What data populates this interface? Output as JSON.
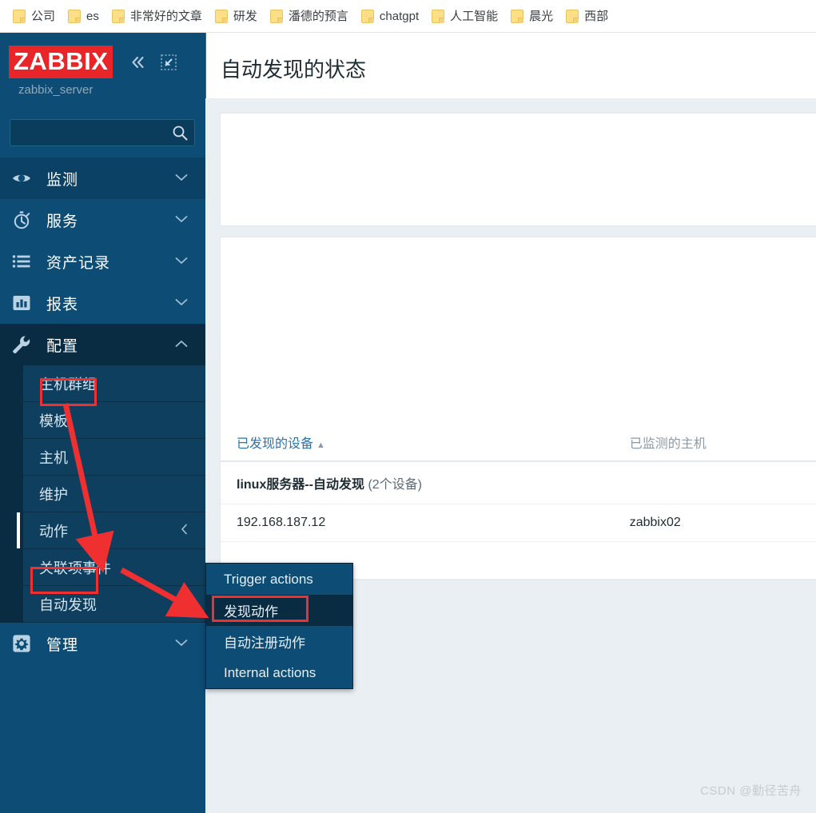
{
  "bookmarks": [
    {
      "label": "公司",
      "icon": "folder-icon"
    },
    {
      "label": "es",
      "icon": "folder-icon"
    },
    {
      "label": "非常好的文章",
      "icon": "folder-icon"
    },
    {
      "label": "研发",
      "icon": "folder-icon"
    },
    {
      "label": "潘德的预言",
      "icon": "folder-icon"
    },
    {
      "label": "chatgpt",
      "icon": "folder-icon"
    },
    {
      "label": "人工智能",
      "icon": "folder-icon"
    },
    {
      "label": "晨光",
      "icon": "folder-icon"
    },
    {
      "label": "西部",
      "icon": "folder-icon"
    }
  ],
  "sidebar": {
    "logo": "ZABBIX",
    "server_name": "zabbix_server",
    "collapse_icon": "double-chevron-left-icon",
    "compact_icon": "collapse-to-corner-icon",
    "search": {
      "value": "",
      "placeholder": "",
      "icon": "search-icon"
    },
    "menu": [
      {
        "label": "监测",
        "icon": "eye-icon",
        "chevron": "chevron-down-icon",
        "state": "highlighted"
      },
      {
        "label": "服务",
        "icon": "stopwatch-icon",
        "chevron": "chevron-down-icon",
        "state": "normal"
      },
      {
        "label": "资产记录",
        "icon": "list-icon",
        "chevron": "chevron-down-icon",
        "state": "normal"
      },
      {
        "label": "报表",
        "icon": "bar-chart-icon",
        "chevron": "chevron-down-icon",
        "state": "normal"
      },
      {
        "label": "配置",
        "icon": "wrench-icon",
        "chevron": "chevron-up-icon",
        "state": "expanded"
      }
    ],
    "submenu": [
      {
        "label": "主机群组"
      },
      {
        "label": "模板"
      },
      {
        "label": "主机"
      },
      {
        "label": "维护"
      },
      {
        "label": "动作",
        "chevron": "chevron-left-icon",
        "active": true
      },
      {
        "label": "关联项事件"
      },
      {
        "label": "自动发现"
      }
    ],
    "menu_bottom": [
      {
        "label": "管理",
        "icon": "gear-icon",
        "chevron": "chevron-down-icon"
      }
    ]
  },
  "flyout": {
    "items": [
      {
        "label": "Trigger actions",
        "hover": false
      },
      {
        "label": "发现动作",
        "hover": true
      },
      {
        "label": "自动注册动作",
        "hover": false
      },
      {
        "label": "Internal actions",
        "hover": false
      }
    ]
  },
  "main": {
    "page_title": "自动发现的状态",
    "table": {
      "columns": [
        {
          "label": "已发现的设备",
          "sorted": true,
          "sort_arrow": "▲"
        },
        {
          "label": "已监测的主机",
          "sorted": false,
          "sort_arrow": ""
        }
      ],
      "group": {
        "name": "linux服务器--自动发现",
        "count": "(2个设备)"
      },
      "rows": [
        {
          "device": "192.168.187.12",
          "host": "zabbix02"
        }
      ]
    }
  },
  "watermark": "CSDN @勤径苦舟",
  "colors": {
    "brand_red": "#e8262a",
    "sidebar_bg": "#0d4d75",
    "sidebar_dark": "#0a2c42",
    "annotation_red": "#f03030",
    "link_blue": "#2e72a8"
  }
}
